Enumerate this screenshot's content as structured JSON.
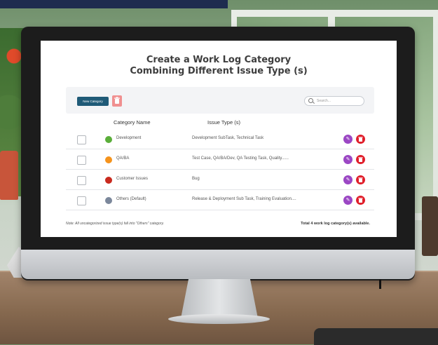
{
  "screen": {
    "title_line1": "Create a Work Log Category",
    "title_line2": "Combining Different Issue Type (s)"
  },
  "toolbar": {
    "new_category_label": "New Category",
    "delete_icon": "trash-icon",
    "search_placeholder": "Search..."
  },
  "table": {
    "headers": [
      "Category Name",
      "Issue Type (s)"
    ],
    "rows": [
      {
        "name": "Development",
        "color": "#5aae3a",
        "issue_types": "Development SubTask, Technical Task"
      },
      {
        "name": "QA/BA",
        "color": "#f5931c",
        "issue_types": "Test Case, QA/BA/Dev, QA Testing Task, Quality......"
      },
      {
        "name": "Customer Issues",
        "color": "#c92a1e",
        "issue_types": "Bug"
      },
      {
        "name": "Others (Default)",
        "color": "#7b879b",
        "issue_types": "Release & Deployment Sub Task, Training Evaluation...."
      }
    ],
    "row_actions": [
      "edit-icon",
      "trash-icon"
    ]
  },
  "footer": {
    "note": "Note: All uncategorized issue type(s) fall into \"Others\" category.",
    "total": "Total 4 work log category(s) available."
  },
  "colors": {
    "new_button": "#1f5a77",
    "edit": "#9b47c4",
    "delete": "#e01e2a"
  }
}
